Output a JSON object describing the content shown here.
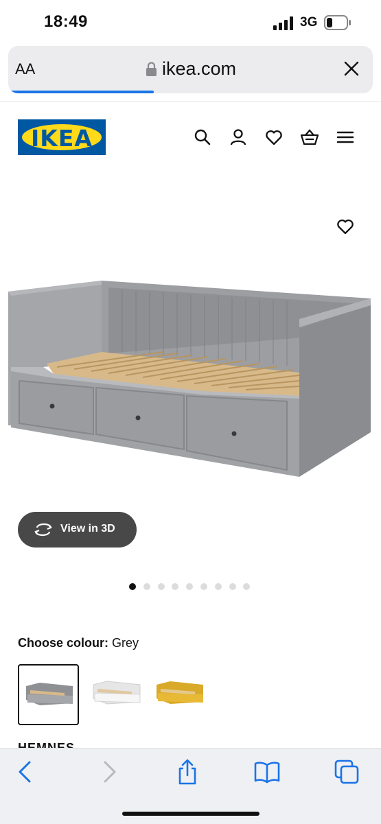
{
  "status_bar": {
    "time": "18:49",
    "network": "3G"
  },
  "browser": {
    "text_size_label": "AA",
    "domain": "ikea.com",
    "load_progress": 0.4
  },
  "header": {
    "logo_text": "IKEA",
    "icons": [
      "search-icon",
      "account-icon",
      "heart-icon",
      "basket-icon",
      "menu-icon"
    ]
  },
  "product": {
    "view_3d_label": "View in 3D",
    "image_count": 9,
    "active_image_index": 0,
    "colour_label": "Choose colour:",
    "colour_value": "Grey",
    "swatches": [
      "Grey",
      "White",
      "Yellow"
    ],
    "name_partial": "HEMNES"
  },
  "colors": {
    "ikea_blue": "#0058a3",
    "ikea_yellow": "#ffda1a",
    "browser_accent": "#1a73e8"
  },
  "bottom_bar": {
    "icons": [
      "back-icon",
      "forward-icon",
      "share-icon",
      "bookmarks-icon",
      "tabs-icon"
    ]
  }
}
